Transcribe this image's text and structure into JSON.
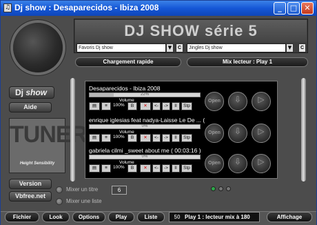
{
  "window": {
    "title": "Dj show : Desaparecidos - Ibiza 2008",
    "app_icon": "dj-show-app-icon",
    "controls": [
      "_",
      "□",
      "✕"
    ]
  },
  "header": {
    "title": "DJ SHOW série 5",
    "favorites_combo": "Favoris Dj show",
    "jingles_combo": "Jingles Dj show",
    "c_button": "C"
  },
  "pills": {
    "quick_load": "Chargement rapide",
    "mix_reader": "Mix lecteur : Play 1"
  },
  "sidebar": {
    "logo_dj": "Dj",
    "logo_show": "show",
    "help": "Aide",
    "tuner_big": "TUNER",
    "tuner_sub": "Height Sensibility",
    "version": "Version",
    "site": "Vbfree.net"
  },
  "decks": [
    {
      "track": "Desaparecidos - Ibiza 2008",
      "progress_label": "22%",
      "progress": 0.22,
      "volume_label": "Volume",
      "volume_value": "100%",
      "b": "B",
      "open": "Open",
      "stp": "Stp",
      "pause": "II"
    },
    {
      "track": "enrique iglesias feat nadya-Laisse Le De ... ( 00:03:56 )",
      "progress_label": "0%",
      "progress": 0.0,
      "volume_label": "Volume",
      "volume_value": "100%",
      "b": "B",
      "open": "Open",
      "stp": "Stp",
      "pause": "II"
    },
    {
      "track": "gabriela cilmi _sweet about me ( 00:03:16 )",
      "progress_label": "0%",
      "progress": 0.0,
      "volume_label": "Volume",
      "volume_value": "100%",
      "b": "B",
      "open": "Open",
      "stp": "Stp",
      "pause": "II"
    }
  ],
  "mix": {
    "mix_title": "Mixer un titre",
    "mix_list": "Mixer une liste",
    "count": "6"
  },
  "bottom": {
    "fichier": "Fichier",
    "look": "Look",
    "options": "Options",
    "play": "Play",
    "liste": "Liste",
    "status_number": "50",
    "status_text": "Play 1 : lecteur mix à 180",
    "affichage": "Affichage"
  }
}
